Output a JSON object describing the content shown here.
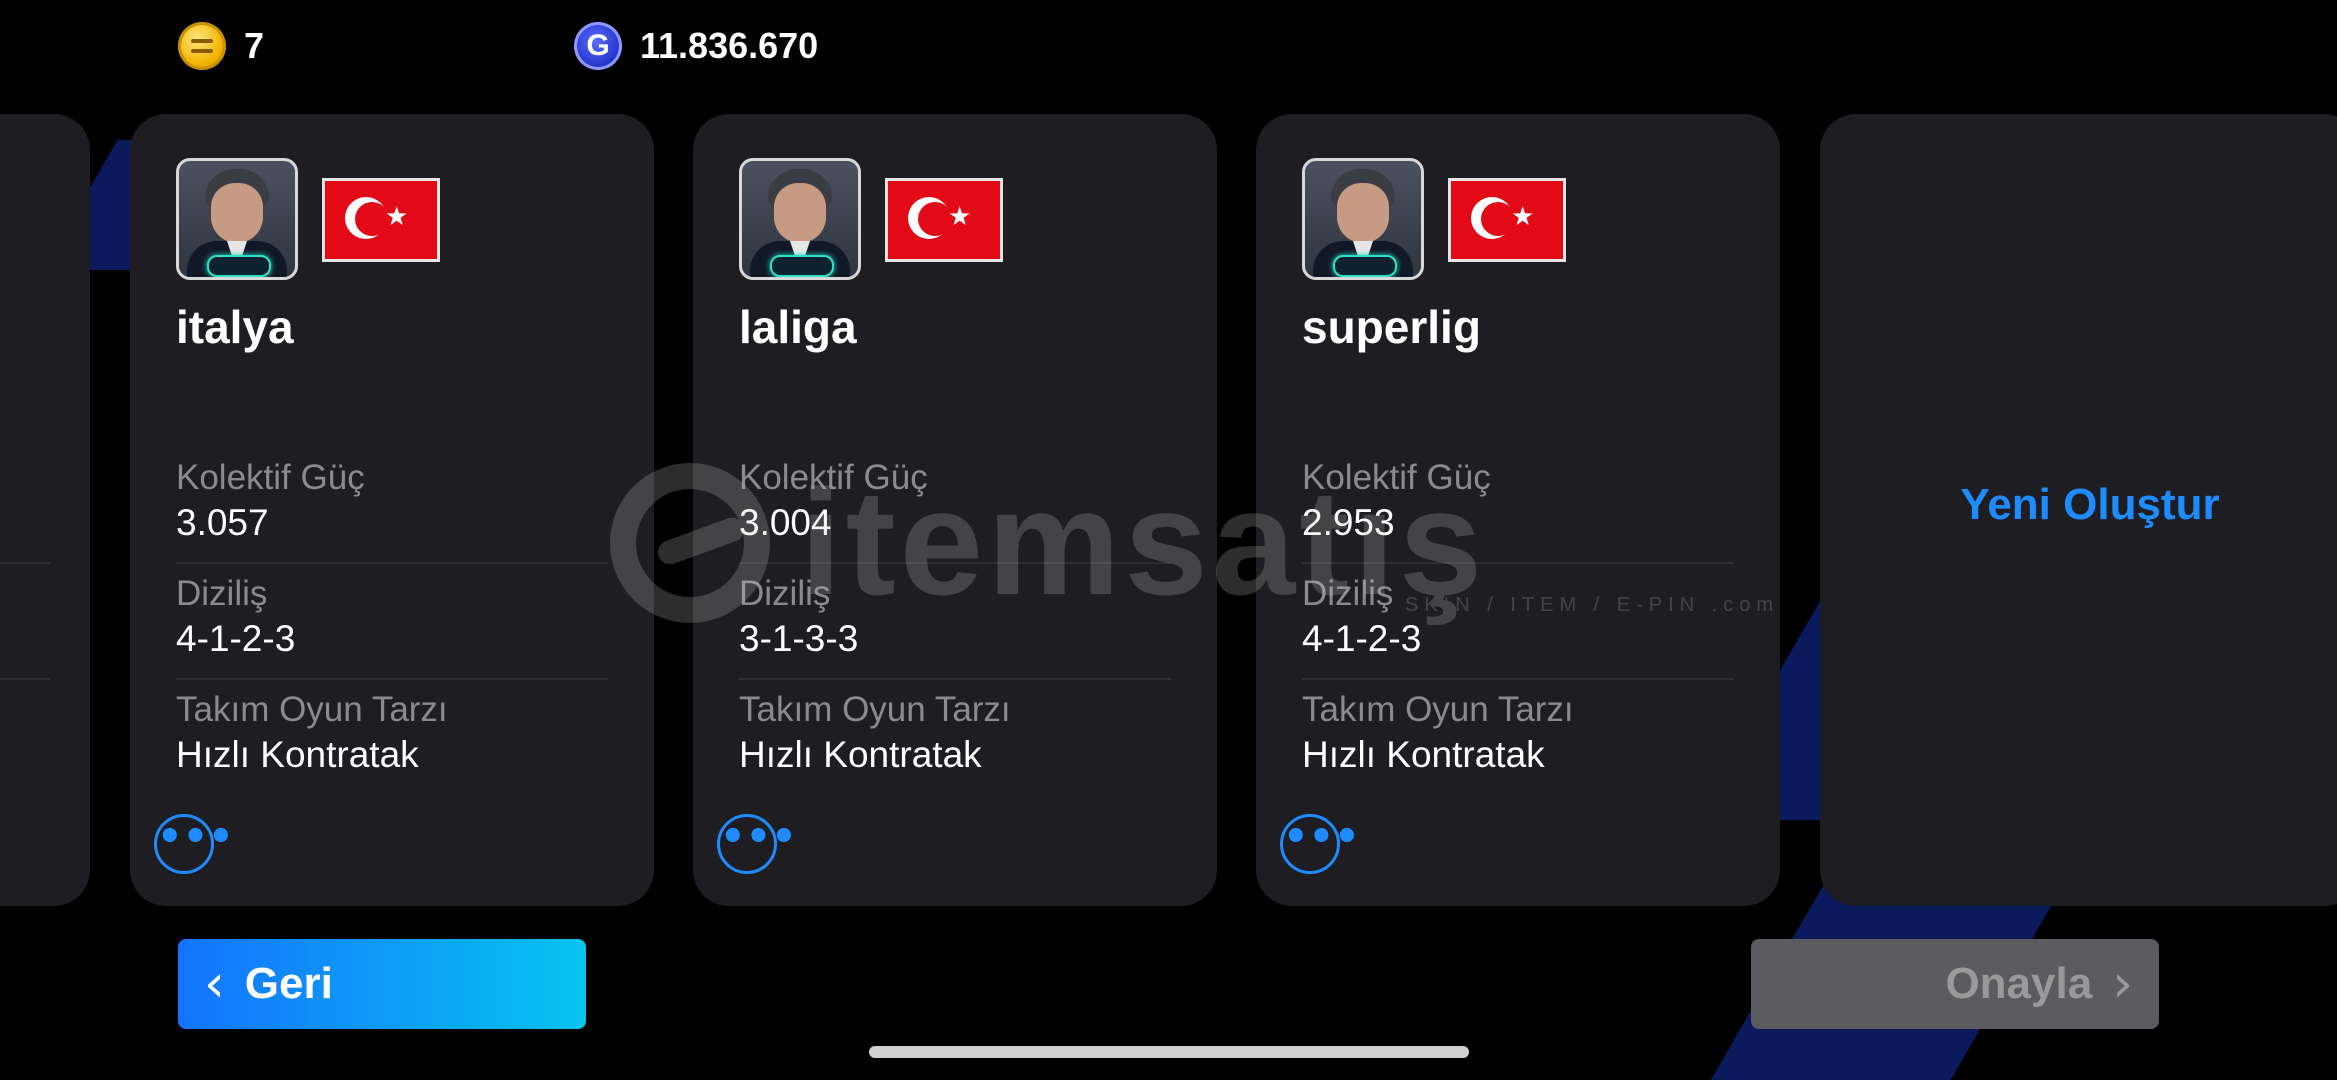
{
  "currencies": {
    "ecoin": {
      "icon": "e-coin-icon",
      "amount": "7"
    },
    "gp": {
      "icon": "gp-coin-icon",
      "glyph": "G",
      "amount": "11.836.670"
    }
  },
  "cards": [
    {
      "name": "italya",
      "stats": [
        {
          "label": "Kolektif Güç",
          "value": "3.057"
        },
        {
          "label": "Diziliş",
          "value": "4-1-2-3"
        },
        {
          "label": "Takım Oyun Tarzı",
          "value": "Hızlı Kontratak"
        }
      ],
      "more": "•••"
    },
    {
      "name": "laliga",
      "stats": [
        {
          "label": "Kolektif Güç",
          "value": "3.004"
        },
        {
          "label": "Diziliş",
          "value": "3-1-3-3"
        },
        {
          "label": "Takım Oyun Tarzı",
          "value": "Hızlı Kontratak"
        }
      ],
      "more": "•••"
    },
    {
      "name": "superlig",
      "stats": [
        {
          "label": "Kolektif Güç",
          "value": "2.953"
        },
        {
          "label": "Diziliş",
          "value": "4-1-2-3"
        },
        {
          "label": "Takım Oyun Tarzı",
          "value": "Hızlı Kontratak"
        }
      ],
      "more": "•••"
    }
  ],
  "new_card": {
    "label": "Yeni Oluştur"
  },
  "buttons": {
    "back": {
      "label": "Geri",
      "chevron": "‹"
    },
    "confirm": {
      "label": "Onayla",
      "chevron": "›"
    }
  },
  "flag_glyph": "★",
  "watermark": {
    "text": "itemsatış",
    "sub": "SKIN / ITEM / E-PIN .com"
  },
  "colors": {
    "accent": "#1e8cff",
    "card_bg": "#1e1e22",
    "flag_red": "#e30a17"
  }
}
